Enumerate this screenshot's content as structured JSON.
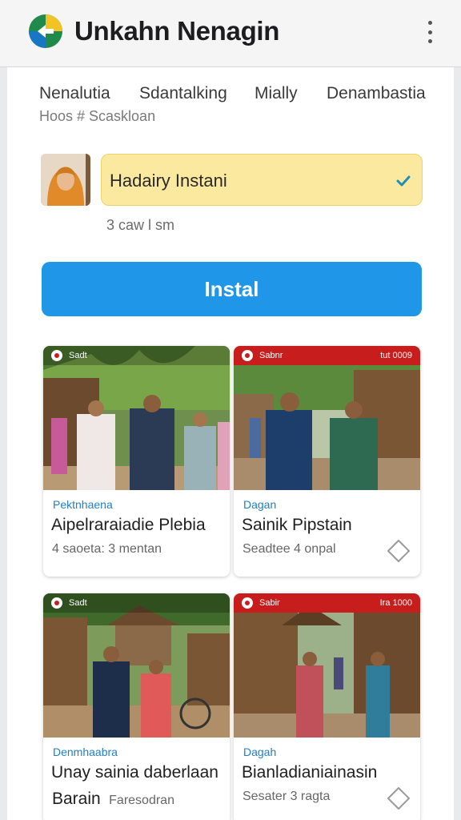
{
  "app": {
    "title": "Unkahn Nenagin",
    "logo_icon": "app-logo-icon",
    "menu_icon": "more-vert-icon",
    "colors": {
      "logo_green": "#1f8a4a",
      "logo_yellow": "#f1c324",
      "logo_blue": "#1976c4"
    }
  },
  "tabs": [
    {
      "label": "Nenalutia"
    },
    {
      "label": "Sdantalking"
    },
    {
      "label": "Mially"
    },
    {
      "label": "Denambastia"
    }
  ],
  "subline": "Hoos # Scaskloan",
  "profile": {
    "select_value": "Hadairy Instani",
    "check_icon": "check-icon",
    "meta": "3 caw l sm"
  },
  "install": {
    "label": "Instal",
    "color": "#1f96e8"
  },
  "cards": [
    {
      "source_left": "Sadt",
      "source_right": "",
      "category": "Pektnhaena",
      "title": "Aipelraraiadie Plebia",
      "subtitle": "4 saoeta: 3 mentan",
      "fav": false,
      "topbar_color": "#2f7d32"
    },
    {
      "source_left": "Sabnr",
      "source_right": "tut 0009",
      "category": "Dagan",
      "title": "Sainik Pipstain",
      "subtitle": "Seadtee 4 onpal",
      "fav": true,
      "topbar_color": "#c81d1d"
    },
    {
      "source_left": "Sadt",
      "source_right": "",
      "category": "Denmhaabra",
      "title": "Unay sainia daberlaan",
      "title2": "Barain",
      "subtitle": "Faresodran",
      "fav": false,
      "topbar_color": "#2f7d32"
    },
    {
      "source_left": "Sabir",
      "source_right": "Ira 1000",
      "category": "Dagah",
      "title": "Bianladianiainasin",
      "subtitle": "Sesater 3 ragta",
      "fav": true,
      "topbar_color": "#c81d1d"
    }
  ]
}
